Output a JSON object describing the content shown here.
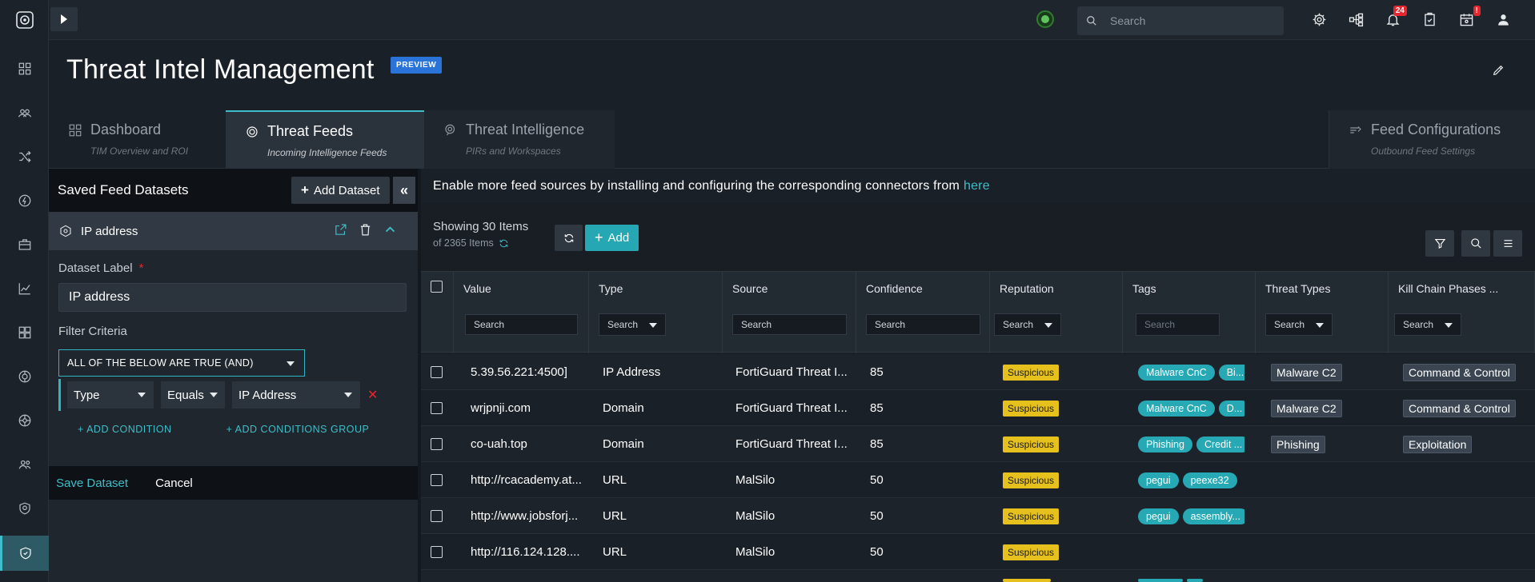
{
  "topbar": {
    "search_placeholder": "Search",
    "notifications_count": "24",
    "alerts_count": "!"
  },
  "header": {
    "title": "Threat Intel Management",
    "badge": "PREVIEW"
  },
  "tabs": [
    {
      "title": "Dashboard",
      "subtitle": "TIM Overview and ROI"
    },
    {
      "title": "Threat Feeds",
      "subtitle": "Incoming Intelligence Feeds"
    },
    {
      "title": "Threat Intelligence",
      "subtitle": "PIRs and Workspaces"
    },
    {
      "title": "Feed Configurations",
      "subtitle": "Outbound Feed Settings"
    }
  ],
  "left_panel": {
    "title": "Saved Feed Datasets",
    "add_dataset": "Add Dataset",
    "dataset_name": "IP address",
    "dataset_label_caption": "Dataset Label",
    "required_mark": "*",
    "dataset_label_value": "IP address",
    "filter_criteria_caption": "Filter Criteria",
    "logic_select": "ALL OF THE BELOW ARE TRUE (AND)",
    "condition": {
      "field": "Type",
      "operator": "Equals",
      "value": "IP Address"
    },
    "add_condition": "+ ADD CONDITION",
    "add_conditions_group": "+ ADD CONDITIONS GROUP",
    "save": "Save Dataset",
    "cancel": "Cancel"
  },
  "notice": {
    "text": "Enable more feed sources by installing and configuring the corresponding connectors from",
    "link": "here"
  },
  "toolbar": {
    "showing": "Showing 30 Items",
    "of_items": "of 2365 Items",
    "add": "Add"
  },
  "grid": {
    "columns": [
      {
        "name": "Value",
        "filter": "Search"
      },
      {
        "name": "Type",
        "filter": "Search"
      },
      {
        "name": "Source",
        "filter": "Search"
      },
      {
        "name": "Confidence",
        "filter": "Search"
      },
      {
        "name": "Reputation",
        "filter": "Search"
      },
      {
        "name": "Tags",
        "filter": "Search"
      },
      {
        "name": "Threat Types",
        "filter": "Search"
      },
      {
        "name": "Kill Chain Phases ...",
        "filter": "Search"
      }
    ],
    "rows": [
      {
        "value": "5.39.56.221:4500]",
        "type": "IP Address",
        "source": "FortiGuard Threat I...",
        "confidence": "85",
        "reputation": "Suspicious",
        "tags": [
          "Malware CnC",
          "Bi..."
        ],
        "threat": "Malware C2",
        "kill": "Command & Control"
      },
      {
        "value": "wrjpnji.com",
        "type": "Domain",
        "source": "FortiGuard Threat I...",
        "confidence": "85",
        "reputation": "Suspicious",
        "tags": [
          "Malware CnC",
          "D..."
        ],
        "threat": "Malware C2",
        "kill": "Command & Control"
      },
      {
        "value": "co-uah.top",
        "type": "Domain",
        "source": "FortiGuard Threat I...",
        "confidence": "85",
        "reputation": "Suspicious",
        "tags": [
          "Phishing",
          "Credit ..."
        ],
        "threat": "Phishing",
        "kill": "Exploitation"
      },
      {
        "value": "http://rcacademy.at...",
        "type": "URL",
        "source": "MalSilo",
        "confidence": "50",
        "reputation": "Suspicious",
        "tags": [
          "pegui",
          "peexe32"
        ],
        "threat": "",
        "kill": ""
      },
      {
        "value": "http://www.jobsforj...",
        "type": "URL",
        "source": "MalSilo",
        "confidence": "50",
        "reputation": "Suspicious",
        "tags": [
          "pegui",
          "assembly..."
        ],
        "threat": "",
        "kill": ""
      },
      {
        "value": "http://116.124.128....",
        "type": "URL",
        "source": "MalSilo",
        "confidence": "50",
        "reputation": "Suspicious",
        "tags": [],
        "threat": "",
        "kill": ""
      }
    ]
  },
  "colors": {
    "accent": "#3fbdc8",
    "suspicious": "#e6c11e",
    "tag": "#27a9b5",
    "badge": "#2a73d8"
  }
}
